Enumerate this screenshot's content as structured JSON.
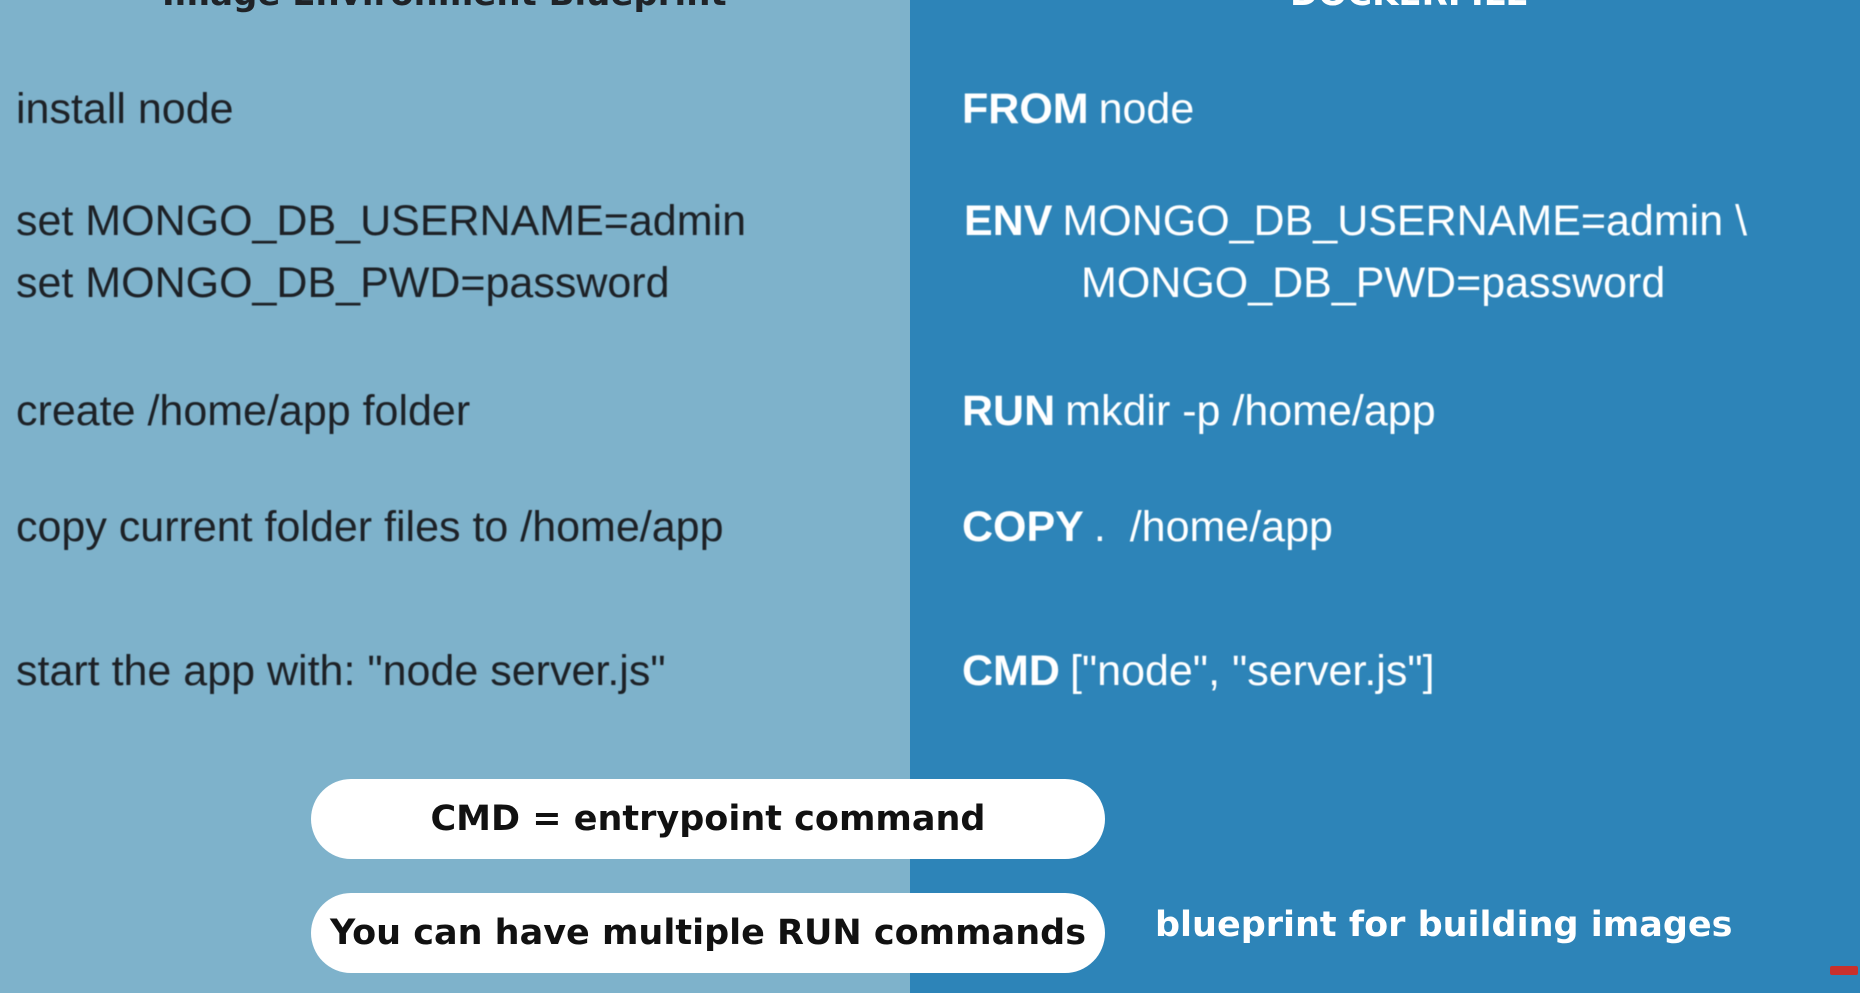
{
  "left": {
    "heading": "Image Environment Blueprint",
    "lines": [
      "install node",
      "set MONGO_DB_USERNAME=admin",
      "set MONGO_DB_PWD=password",
      "create /home/app folder",
      "copy current folder files to /home/app",
      "start the app with: \"node server.js\""
    ]
  },
  "right": {
    "heading": "DOCKERFILE",
    "instructions": [
      {
        "keyword": "FROM",
        "args": "node"
      },
      {
        "keyword": "ENV",
        "args": "MONGO_DB_USERNAME=admin \\"
      },
      {
        "keyword": "",
        "args": "MONGO_DB_PWD=password"
      },
      {
        "keyword": "RUN",
        "args": "mkdir -p /home/app"
      },
      {
        "keyword": "COPY",
        "args": ".  /home/app"
      },
      {
        "keyword": "CMD",
        "args": "[\"node\", \"server.js\"]"
      }
    ]
  },
  "callouts": {
    "cmd_note": "CMD = entrypoint command",
    "run_note": "You can have multiple RUN commands"
  },
  "caption": "blueprint for building images",
  "colors": {
    "left_panel": "#7eb2cb",
    "right_panel": "#2d84b8",
    "pill": "#ffffff"
  }
}
